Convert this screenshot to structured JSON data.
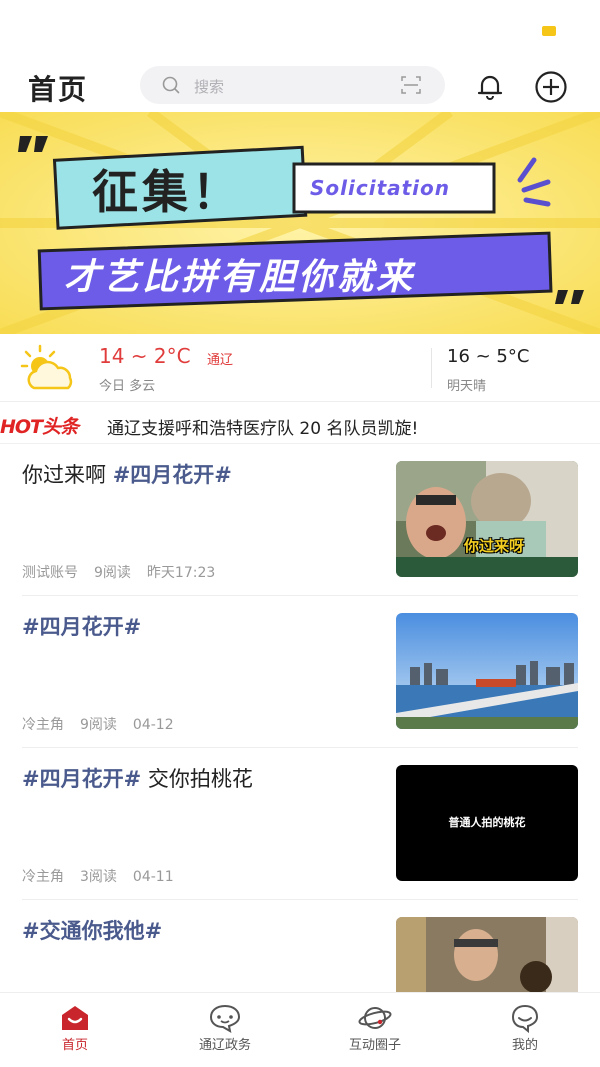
{
  "header": {
    "title": "首页",
    "search_placeholder": "搜索"
  },
  "banner": {
    "headline": "征集！",
    "english": "Solicitation",
    "subline": "才艺比拼有胆你就来"
  },
  "weather": {
    "today_temp": "14 ~ 2°C",
    "city": "通辽",
    "today_label": "今日 多云",
    "tomorrow_temp": "16 ~ 5°C",
    "tomorrow_label": "明天晴"
  },
  "hot": {
    "logo": "HOT头条",
    "headline": "通辽支援呼和浩特医疗队 20 名队员凯旋!"
  },
  "feed": [
    {
      "title_text": "你过来啊 ",
      "tag": "#四月花开#",
      "title_suffix": "",
      "author": "测试账号",
      "reads": "9阅读",
      "time": "昨天17:23",
      "thumb_caption": "你过来呀"
    },
    {
      "title_text": "",
      "tag": "#四月花开#",
      "title_suffix": "",
      "author": "冷主角",
      "reads": "9阅读",
      "time": "04-12",
      "thumb_caption": ""
    },
    {
      "title_text": "",
      "tag": "#四月花开#",
      "title_suffix": " 交你拍桃花",
      "author": "冷主角",
      "reads": "3阅读",
      "time": "04-11",
      "thumb_caption": "普通人拍的桃花"
    },
    {
      "title_text": "",
      "tag": "#交通你我他#",
      "title_suffix": "",
      "author": "",
      "reads": "",
      "time": "",
      "thumb_caption": ""
    }
  ],
  "tabbar": {
    "items": [
      {
        "label": "首页",
        "icon": "home-icon",
        "active": true
      },
      {
        "label": "通辽政务",
        "icon": "chat-icon",
        "active": false
      },
      {
        "label": "互动圈子",
        "icon": "planet-icon",
        "active": false
      },
      {
        "label": "我的",
        "icon": "profile-icon",
        "active": false
      }
    ]
  },
  "colors": {
    "accent": "#c8262c",
    "tag": "#4a5a8c",
    "banner_yellow": "#fbe46a",
    "banner_purple": "#6c5ce7",
    "banner_teal": "#9be3e6"
  }
}
